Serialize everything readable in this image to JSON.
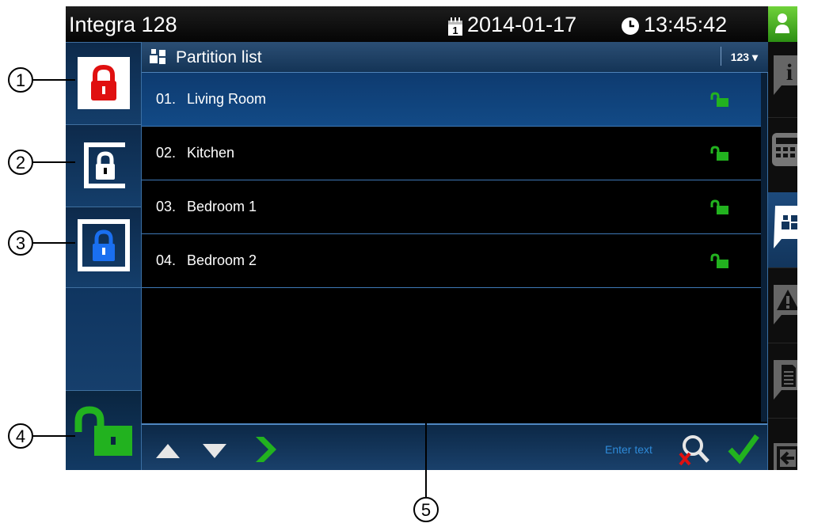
{
  "header": {
    "app_title": "Integra 128",
    "date": "2014-01-17",
    "time": "13:45:42"
  },
  "list": {
    "title": "Partition list",
    "sort_label": "123 ▾",
    "items": [
      {
        "number": "01.",
        "name": "Living Room",
        "selected": true
      },
      {
        "number": "02.",
        "name": "Kitchen",
        "selected": false
      },
      {
        "number": "03.",
        "name": "Bedroom 1",
        "selected": false
      },
      {
        "number": "04.",
        "name": "Bedroom 2",
        "selected": false
      }
    ]
  },
  "toolbar": {
    "search_placeholder": "Enter text"
  },
  "left_buttons": [
    "full-arm",
    "night-arm",
    "day-arm",
    "disarm"
  ],
  "right_tabs": [
    "info-icon",
    "keypad-icon",
    "partitions-icon",
    "alarm-icon",
    "log-icon",
    "exit-icon"
  ],
  "callouts": [
    "1",
    "2",
    "3",
    "4",
    "5"
  ],
  "colors": {
    "accent_blue": "#124a86",
    "lock_red": "#e01010",
    "lock_blue": "#1a6ff0",
    "lock_green": "#22b21f",
    "user_green": "#4cbb2a"
  }
}
